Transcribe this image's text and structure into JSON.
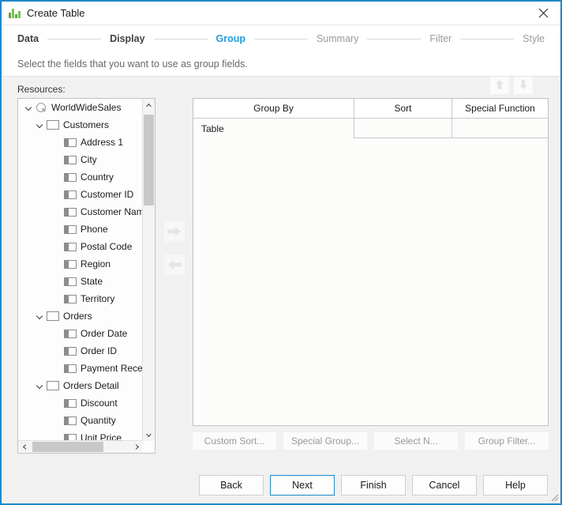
{
  "window": {
    "title": "Create Table",
    "app_icon": "bar-chart-icon",
    "close_icon": "close-icon",
    "accent_color": "#1f87c8"
  },
  "steps": [
    {
      "label": "Data",
      "state": "done"
    },
    {
      "label": "Display",
      "state": "done"
    },
    {
      "label": "Group",
      "state": "current"
    },
    {
      "label": "Summary",
      "state": "todo"
    },
    {
      "label": "Filter",
      "state": "todo"
    },
    {
      "label": "Style",
      "state": "todo"
    }
  ],
  "description": "Select the fields that you want to use as group fields.",
  "resources": {
    "label": "Resources:",
    "tree": [
      {
        "label": "WorldWideSales",
        "level": 0,
        "icon": "query-icon",
        "expanded": true
      },
      {
        "label": "Customers",
        "level": 1,
        "icon": "table-icon",
        "expanded": true
      },
      {
        "label": "Address 1",
        "level": 2,
        "icon": "field-icon"
      },
      {
        "label": "City",
        "level": 2,
        "icon": "field-icon"
      },
      {
        "label": "Country",
        "level": 2,
        "icon": "field-icon"
      },
      {
        "label": "Customer ID",
        "level": 2,
        "icon": "field-icon"
      },
      {
        "label": "Customer Name",
        "level": 2,
        "icon": "field-icon"
      },
      {
        "label": "Phone",
        "level": 2,
        "icon": "field-icon"
      },
      {
        "label": "Postal Code",
        "level": 2,
        "icon": "field-icon"
      },
      {
        "label": "Region",
        "level": 2,
        "icon": "field-icon"
      },
      {
        "label": "State",
        "level": 2,
        "icon": "field-icon"
      },
      {
        "label": "Territory",
        "level": 2,
        "icon": "field-icon"
      },
      {
        "label": "Orders",
        "level": 1,
        "icon": "table-icon",
        "expanded": true
      },
      {
        "label": "Order Date",
        "level": 2,
        "icon": "field-icon"
      },
      {
        "label": "Order ID",
        "level": 2,
        "icon": "field-icon"
      },
      {
        "label": "Payment Received",
        "level": 2,
        "icon": "field-icon"
      },
      {
        "label": "Orders Detail",
        "level": 1,
        "icon": "table-icon",
        "expanded": true
      },
      {
        "label": "Discount",
        "level": 2,
        "icon": "field-icon"
      },
      {
        "label": "Quantity",
        "level": 2,
        "icon": "field-icon"
      },
      {
        "label": "Unit Price",
        "level": 2,
        "icon": "field-icon"
      }
    ]
  },
  "transfer": {
    "add_icon": "arrow-right-icon",
    "remove_icon": "arrow-left-icon"
  },
  "reorder": {
    "up_icon": "arrow-up-icon",
    "down_icon": "arrow-down-icon"
  },
  "grid": {
    "columns": [
      "Group By",
      "Sort",
      "Special Function"
    ],
    "rows": [
      {
        "group_by": "Table",
        "sort": "",
        "special_function": ""
      }
    ]
  },
  "secondary_buttons": [
    {
      "label": "Custom Sort..."
    },
    {
      "label": "Special Group..."
    },
    {
      "label": "Select N..."
    },
    {
      "label": "Group Filter..."
    }
  ],
  "footer_buttons": [
    {
      "label": "Back",
      "primary": false
    },
    {
      "label": "Next",
      "primary": true
    },
    {
      "label": "Finish",
      "primary": false
    },
    {
      "label": "Cancel",
      "primary": false
    },
    {
      "label": "Help",
      "primary": false
    }
  ]
}
